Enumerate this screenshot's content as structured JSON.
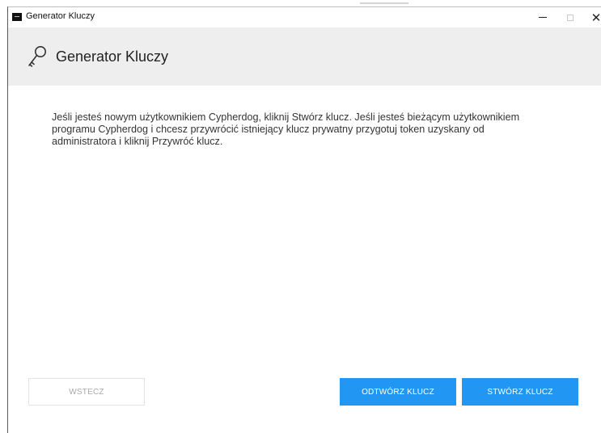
{
  "window": {
    "title": "Generator Kluczy",
    "minimize_glyph": "",
    "maximize_glyph": "",
    "close_glyph": "✕"
  },
  "header": {
    "title": "Generator Kluczy",
    "icon": "key-icon"
  },
  "message": {
    "lines": [
      "Jeśli jesteś nowym użytkownikiem Cypherdog, kliknij Stwórz klucz. Jeśli jesteś bieżącym użytkownikiem",
      "programu Cypherdog i chcesz przywrócić istniejący klucz prywatny przygotuj token uzyskany od",
      "administratora i kliknij Przywróć klucz."
    ]
  },
  "buttons": {
    "back": {
      "label": "WSTECZ",
      "state": "disabled"
    },
    "restore": {
      "label": "ODTWÓRZ KLUCZ"
    },
    "create": {
      "label": "STWÓRZ KLUCZ"
    }
  },
  "colors": {
    "accent": "#2196f3",
    "header_bg": "#eeeeee",
    "text": "#333333",
    "disabled_text": "#a9a9a9"
  }
}
